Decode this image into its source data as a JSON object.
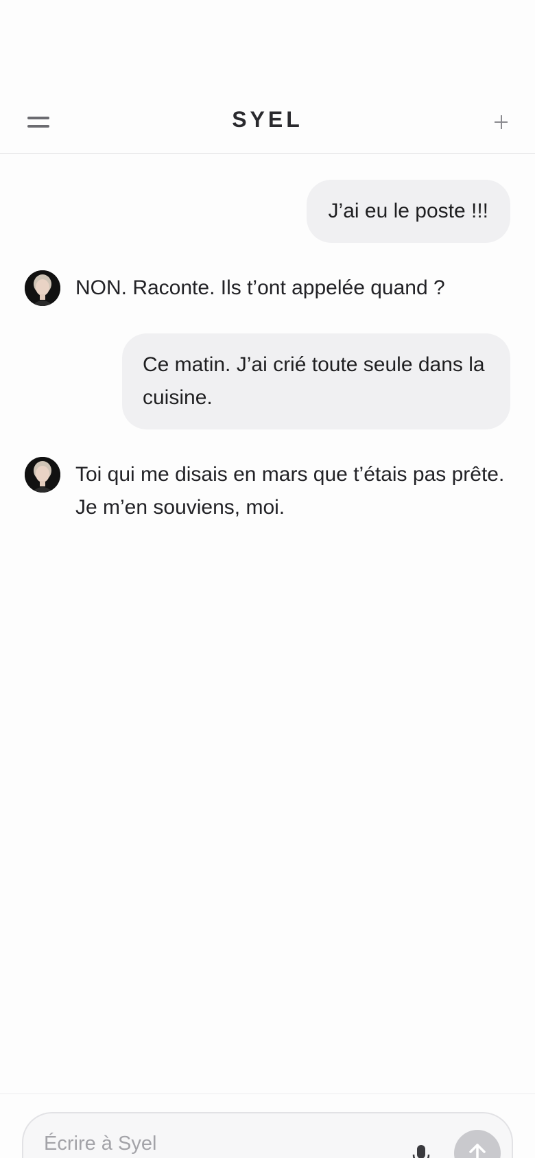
{
  "header": {
    "title": "SYEL",
    "menu_icon": "menu-icon",
    "new_icon": "plus-icon"
  },
  "messages": [
    {
      "role": "user",
      "text": "J’ai eu le poste !!!"
    },
    {
      "role": "assistant",
      "text": "NON. Raconte. Ils t’ont appelée quand ?",
      "avatar": "avatar"
    },
    {
      "role": "user",
      "text": "Ce matin. J’ai crié toute seule dans la cuisine."
    },
    {
      "role": "assistant",
      "text": "Toi qui me disais en mars que t’étais pas prête. Je m’en souviens, moi.",
      "avatar": "avatar"
    }
  ],
  "composer": {
    "placeholder": "Écrire à Syel",
    "value": "",
    "mic_icon": "mic-icon",
    "send_icon": "arrow-up-icon"
  },
  "colors": {
    "user_bubble": "#f0f0f2",
    "text": "#1f1f21",
    "send_button": "#c9c9cd"
  }
}
